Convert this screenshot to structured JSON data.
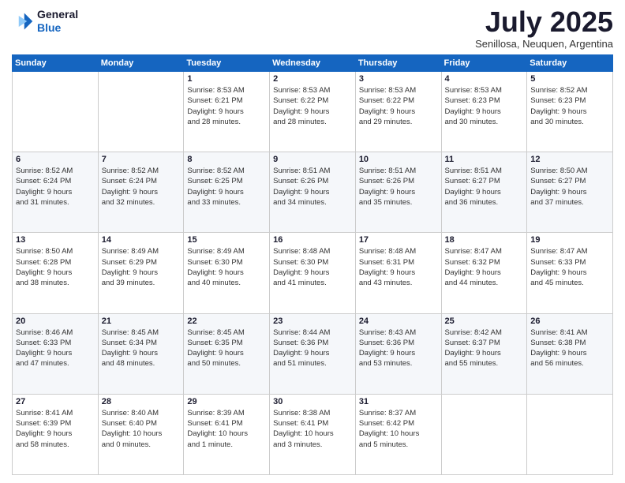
{
  "header": {
    "logo_line1": "General",
    "logo_line2": "Blue",
    "month": "July 2025",
    "location": "Senillosa, Neuquen, Argentina"
  },
  "weekdays": [
    "Sunday",
    "Monday",
    "Tuesday",
    "Wednesday",
    "Thursday",
    "Friday",
    "Saturday"
  ],
  "weeks": [
    [
      {
        "day": "",
        "info": ""
      },
      {
        "day": "",
        "info": ""
      },
      {
        "day": "1",
        "info": "Sunrise: 8:53 AM\nSunset: 6:21 PM\nDaylight: 9 hours\nand 28 minutes."
      },
      {
        "day": "2",
        "info": "Sunrise: 8:53 AM\nSunset: 6:22 PM\nDaylight: 9 hours\nand 28 minutes."
      },
      {
        "day": "3",
        "info": "Sunrise: 8:53 AM\nSunset: 6:22 PM\nDaylight: 9 hours\nand 29 minutes."
      },
      {
        "day": "4",
        "info": "Sunrise: 8:53 AM\nSunset: 6:23 PM\nDaylight: 9 hours\nand 30 minutes."
      },
      {
        "day": "5",
        "info": "Sunrise: 8:52 AM\nSunset: 6:23 PM\nDaylight: 9 hours\nand 30 minutes."
      }
    ],
    [
      {
        "day": "6",
        "info": "Sunrise: 8:52 AM\nSunset: 6:24 PM\nDaylight: 9 hours\nand 31 minutes."
      },
      {
        "day": "7",
        "info": "Sunrise: 8:52 AM\nSunset: 6:24 PM\nDaylight: 9 hours\nand 32 minutes."
      },
      {
        "day": "8",
        "info": "Sunrise: 8:52 AM\nSunset: 6:25 PM\nDaylight: 9 hours\nand 33 minutes."
      },
      {
        "day": "9",
        "info": "Sunrise: 8:51 AM\nSunset: 6:26 PM\nDaylight: 9 hours\nand 34 minutes."
      },
      {
        "day": "10",
        "info": "Sunrise: 8:51 AM\nSunset: 6:26 PM\nDaylight: 9 hours\nand 35 minutes."
      },
      {
        "day": "11",
        "info": "Sunrise: 8:51 AM\nSunset: 6:27 PM\nDaylight: 9 hours\nand 36 minutes."
      },
      {
        "day": "12",
        "info": "Sunrise: 8:50 AM\nSunset: 6:27 PM\nDaylight: 9 hours\nand 37 minutes."
      }
    ],
    [
      {
        "day": "13",
        "info": "Sunrise: 8:50 AM\nSunset: 6:28 PM\nDaylight: 9 hours\nand 38 minutes."
      },
      {
        "day": "14",
        "info": "Sunrise: 8:49 AM\nSunset: 6:29 PM\nDaylight: 9 hours\nand 39 minutes."
      },
      {
        "day": "15",
        "info": "Sunrise: 8:49 AM\nSunset: 6:30 PM\nDaylight: 9 hours\nand 40 minutes."
      },
      {
        "day": "16",
        "info": "Sunrise: 8:48 AM\nSunset: 6:30 PM\nDaylight: 9 hours\nand 41 minutes."
      },
      {
        "day": "17",
        "info": "Sunrise: 8:48 AM\nSunset: 6:31 PM\nDaylight: 9 hours\nand 43 minutes."
      },
      {
        "day": "18",
        "info": "Sunrise: 8:47 AM\nSunset: 6:32 PM\nDaylight: 9 hours\nand 44 minutes."
      },
      {
        "day": "19",
        "info": "Sunrise: 8:47 AM\nSunset: 6:33 PM\nDaylight: 9 hours\nand 45 minutes."
      }
    ],
    [
      {
        "day": "20",
        "info": "Sunrise: 8:46 AM\nSunset: 6:33 PM\nDaylight: 9 hours\nand 47 minutes."
      },
      {
        "day": "21",
        "info": "Sunrise: 8:45 AM\nSunset: 6:34 PM\nDaylight: 9 hours\nand 48 minutes."
      },
      {
        "day": "22",
        "info": "Sunrise: 8:45 AM\nSunset: 6:35 PM\nDaylight: 9 hours\nand 50 minutes."
      },
      {
        "day": "23",
        "info": "Sunrise: 8:44 AM\nSunset: 6:36 PM\nDaylight: 9 hours\nand 51 minutes."
      },
      {
        "day": "24",
        "info": "Sunrise: 8:43 AM\nSunset: 6:36 PM\nDaylight: 9 hours\nand 53 minutes."
      },
      {
        "day": "25",
        "info": "Sunrise: 8:42 AM\nSunset: 6:37 PM\nDaylight: 9 hours\nand 55 minutes."
      },
      {
        "day": "26",
        "info": "Sunrise: 8:41 AM\nSunset: 6:38 PM\nDaylight: 9 hours\nand 56 minutes."
      }
    ],
    [
      {
        "day": "27",
        "info": "Sunrise: 8:41 AM\nSunset: 6:39 PM\nDaylight: 9 hours\nand 58 minutes."
      },
      {
        "day": "28",
        "info": "Sunrise: 8:40 AM\nSunset: 6:40 PM\nDaylight: 10 hours\nand 0 minutes."
      },
      {
        "day": "29",
        "info": "Sunrise: 8:39 AM\nSunset: 6:41 PM\nDaylight: 10 hours\nand 1 minute."
      },
      {
        "day": "30",
        "info": "Sunrise: 8:38 AM\nSunset: 6:41 PM\nDaylight: 10 hours\nand 3 minutes."
      },
      {
        "day": "31",
        "info": "Sunrise: 8:37 AM\nSunset: 6:42 PM\nDaylight: 10 hours\nand 5 minutes."
      },
      {
        "day": "",
        "info": ""
      },
      {
        "day": "",
        "info": ""
      }
    ]
  ]
}
